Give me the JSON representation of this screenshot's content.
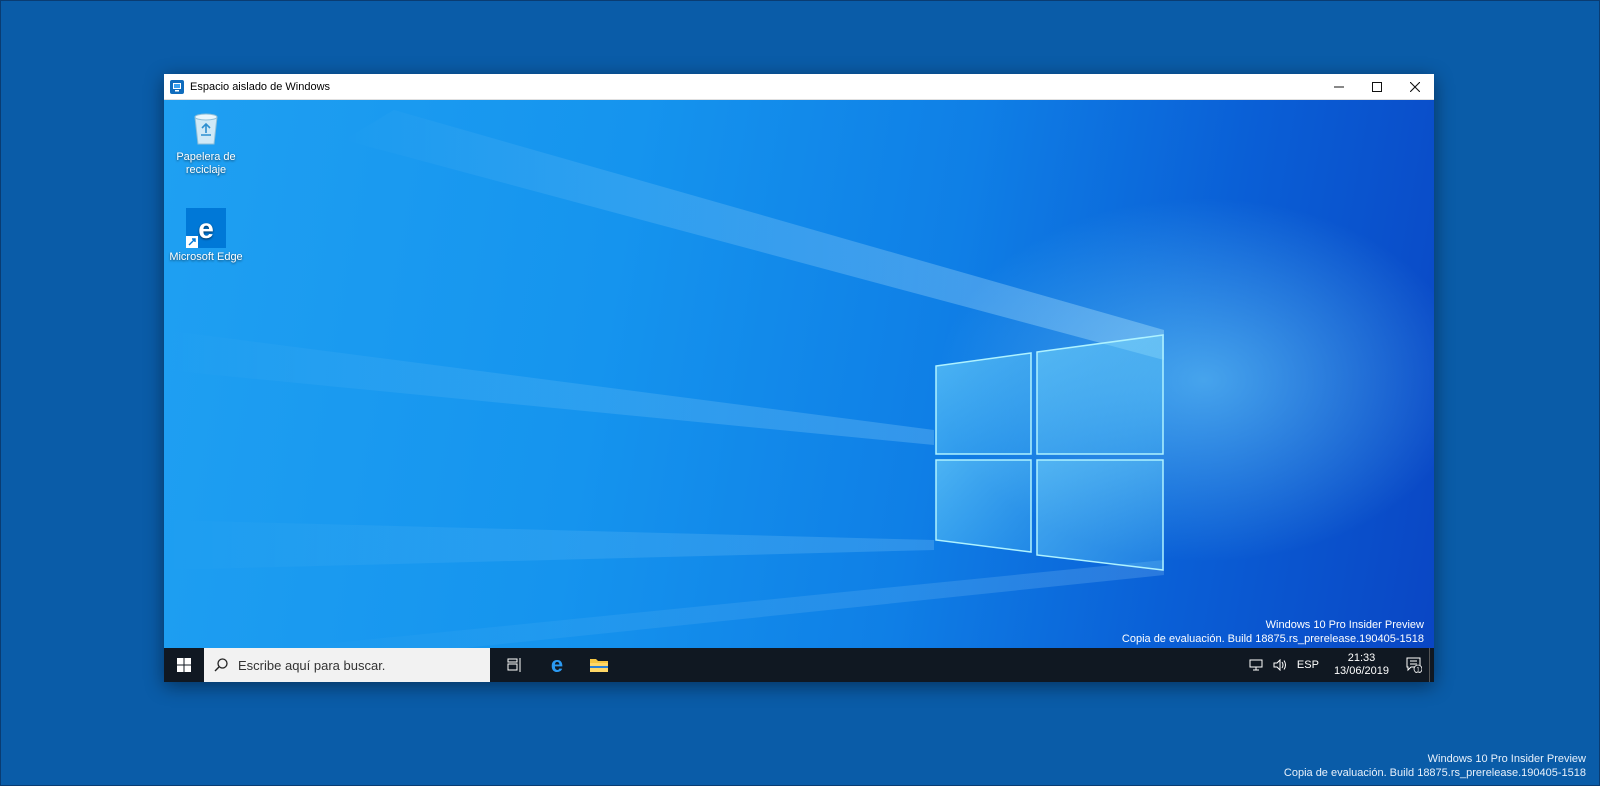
{
  "window": {
    "title": "Espacio aislado de Windows",
    "controls": {
      "minimize": "—",
      "maximize": "☐",
      "close": "✕"
    }
  },
  "desktop": {
    "icons": [
      {
        "label_line1": "Papelera de",
        "label_line2": "reciclaje",
        "icon": "recycle-bin-icon"
      },
      {
        "label_line1": "Microsoft Edge",
        "label_line2": "",
        "icon": "edge-icon"
      }
    ],
    "watermark": {
      "line1": "Windows 10 Pro Insider Preview",
      "line2": "Copia de evaluación. Build 18875.rs_prerelease.190405-1518"
    }
  },
  "taskbar": {
    "search_placeholder": "Escribe aquí para buscar.",
    "language": "ESP",
    "time": "21:33",
    "date": "13/06/2019",
    "notification_count": "1"
  },
  "outer_watermark": {
    "line1": "Windows 10 Pro Insider Preview",
    "line2": "Copia de evaluación. Build 18875.rs_prerelease.190405-1518"
  },
  "colors": {
    "host_background": "#0b5aa6",
    "taskbar": "#101822",
    "accent": "#0078d7"
  }
}
